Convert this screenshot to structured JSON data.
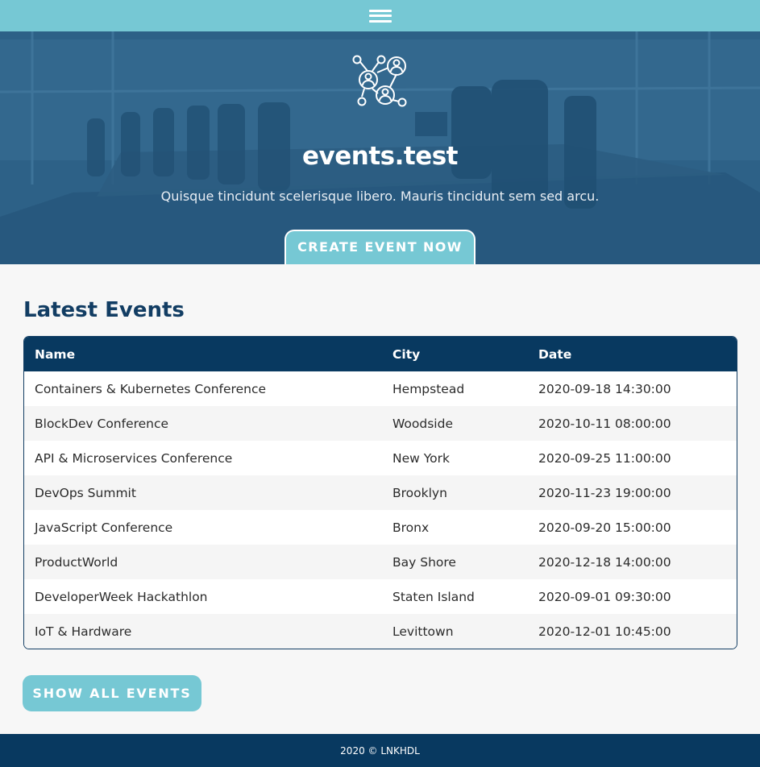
{
  "header": {
    "menu_icon": "hamburger-menu-icon",
    "color": "#76c8d4"
  },
  "hero": {
    "logo_icon": "network-people-icon",
    "title": "events.test",
    "subtitle": "Quisque tincidunt scelerisque libero. Mauris tincidunt sem sed arcu.",
    "cta_label": "CREATE EVENT NOW"
  },
  "main": {
    "title": "Latest Events",
    "table": {
      "columns": [
        "Name",
        "City",
        "Date"
      ],
      "rows": [
        [
          "Containers & Kubernetes Conference",
          "Hempstead",
          "2020-09-18 14:30:00"
        ],
        [
          "BlockDev Conference",
          "Woodside",
          "2020-10-11 08:00:00"
        ],
        [
          "API & Microservices Conference",
          "New York",
          "2020-09-25 11:00:00"
        ],
        [
          "DevOps Summit",
          "Brooklyn",
          "2020-11-23 19:00:00"
        ],
        [
          "JavaScript Conference",
          "Bronx",
          "2020-09-20 15:00:00"
        ],
        [
          "ProductWorld",
          "Bay Shore",
          "2020-12-18 14:00:00"
        ],
        [
          "DeveloperWeek Hackathlon",
          "Staten Island",
          "2020-09-01 09:30:00"
        ],
        [
          "IoT & Hardware",
          "Levittown",
          "2020-12-01 10:45:00"
        ]
      ]
    },
    "show_all_label": "SHOW ALL EVENTS"
  },
  "footer": {
    "text": "2020 © LNKHDL"
  },
  "colors": {
    "accent": "#76c8d4",
    "navy": "#083960",
    "heading": "#123d63"
  }
}
